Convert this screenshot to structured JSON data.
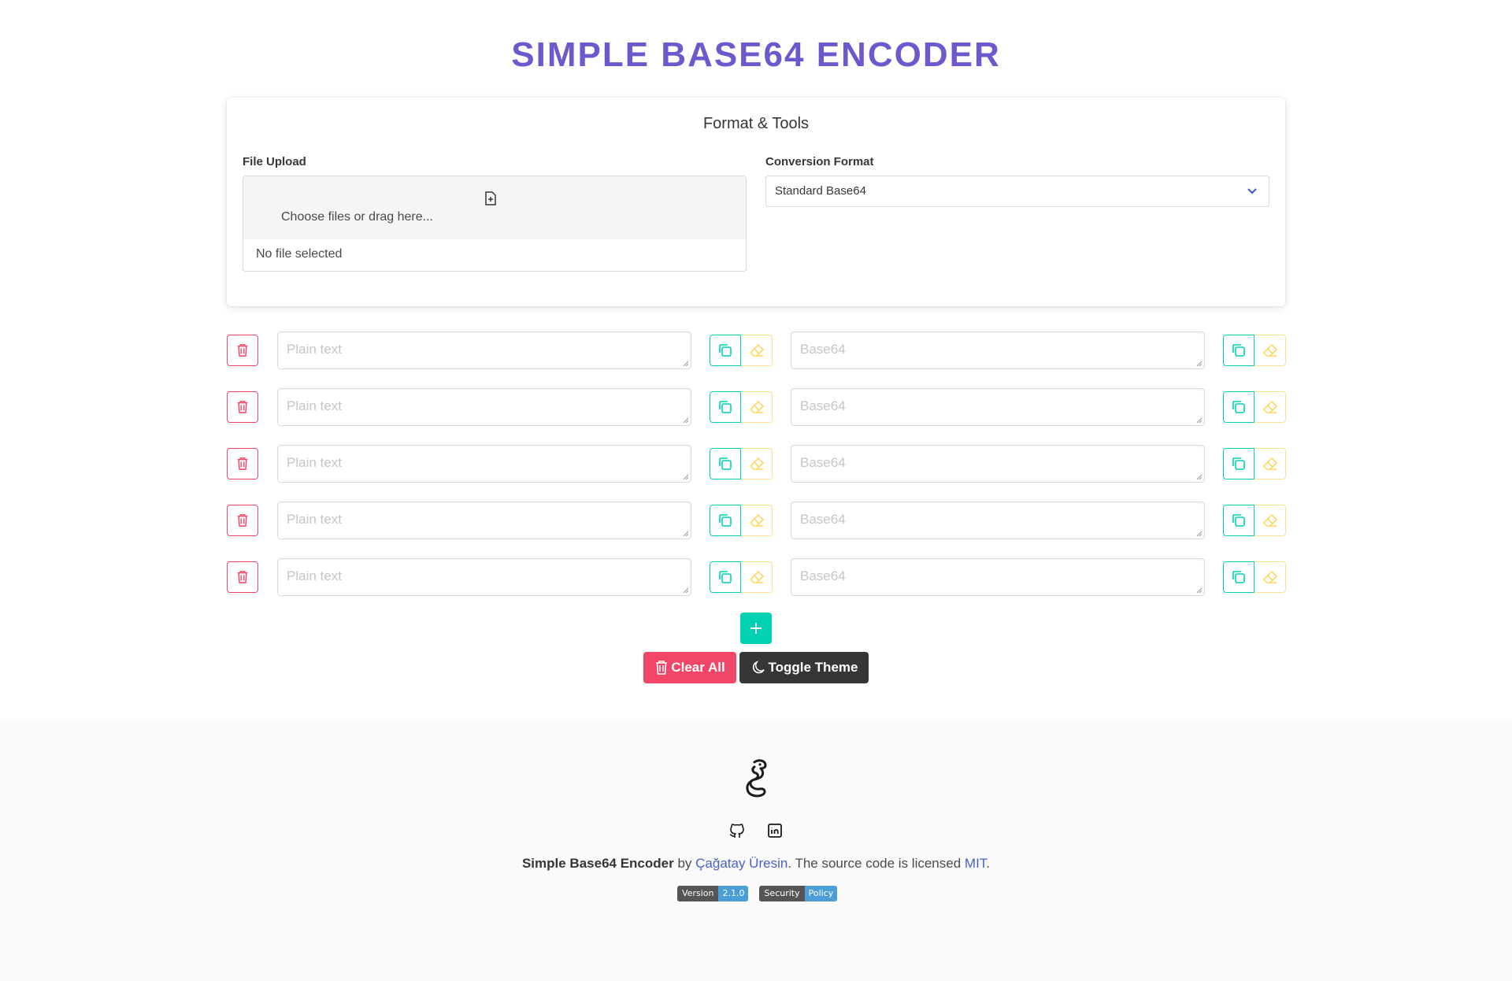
{
  "page": {
    "title": "SIMPLE BASE64 ENCODER"
  },
  "tools": {
    "heading": "Format & Tools",
    "file_upload_label": "File Upload",
    "file_cta": "Choose files or drag here...",
    "file_name": "No file selected",
    "format_label": "Conversion Format",
    "format_value": "Standard Base64"
  },
  "rows": [
    {
      "plain_placeholder": "Plain text",
      "base64_placeholder": "Base64"
    },
    {
      "plain_placeholder": "Plain text",
      "base64_placeholder": "Base64"
    },
    {
      "plain_placeholder": "Plain text",
      "base64_placeholder": "Base64"
    },
    {
      "plain_placeholder": "Plain text",
      "base64_placeholder": "Base64"
    },
    {
      "plain_placeholder": "Plain text",
      "base64_placeholder": "Base64"
    }
  ],
  "actions": {
    "clear_label": "Clear All",
    "theme_label": "Toggle Theme"
  },
  "footer": {
    "app_name": "Simple Base64 Encoder",
    "by": " by ",
    "author": "Çağatay Üresin",
    "license_text": ". The source code is licensed ",
    "license": "MIT",
    "period": ".",
    "badges": [
      {
        "key": "Version",
        "value": "2.1.0"
      },
      {
        "key": "Security",
        "value": "Policy"
      }
    ]
  },
  "colors": {
    "title": "#6a5acd",
    "danger": "#f14668",
    "primary": "#00d1b2",
    "warning": "#ffe08a",
    "dark": "#363636",
    "link": "#485fc7"
  },
  "icons": [
    "file-upload-icon",
    "chevron-down-icon",
    "trash-icon",
    "copy-icon",
    "eraser-icon",
    "plus-icon",
    "moon-icon",
    "seahorse-logo",
    "github-icon",
    "linkedin-icon"
  ]
}
